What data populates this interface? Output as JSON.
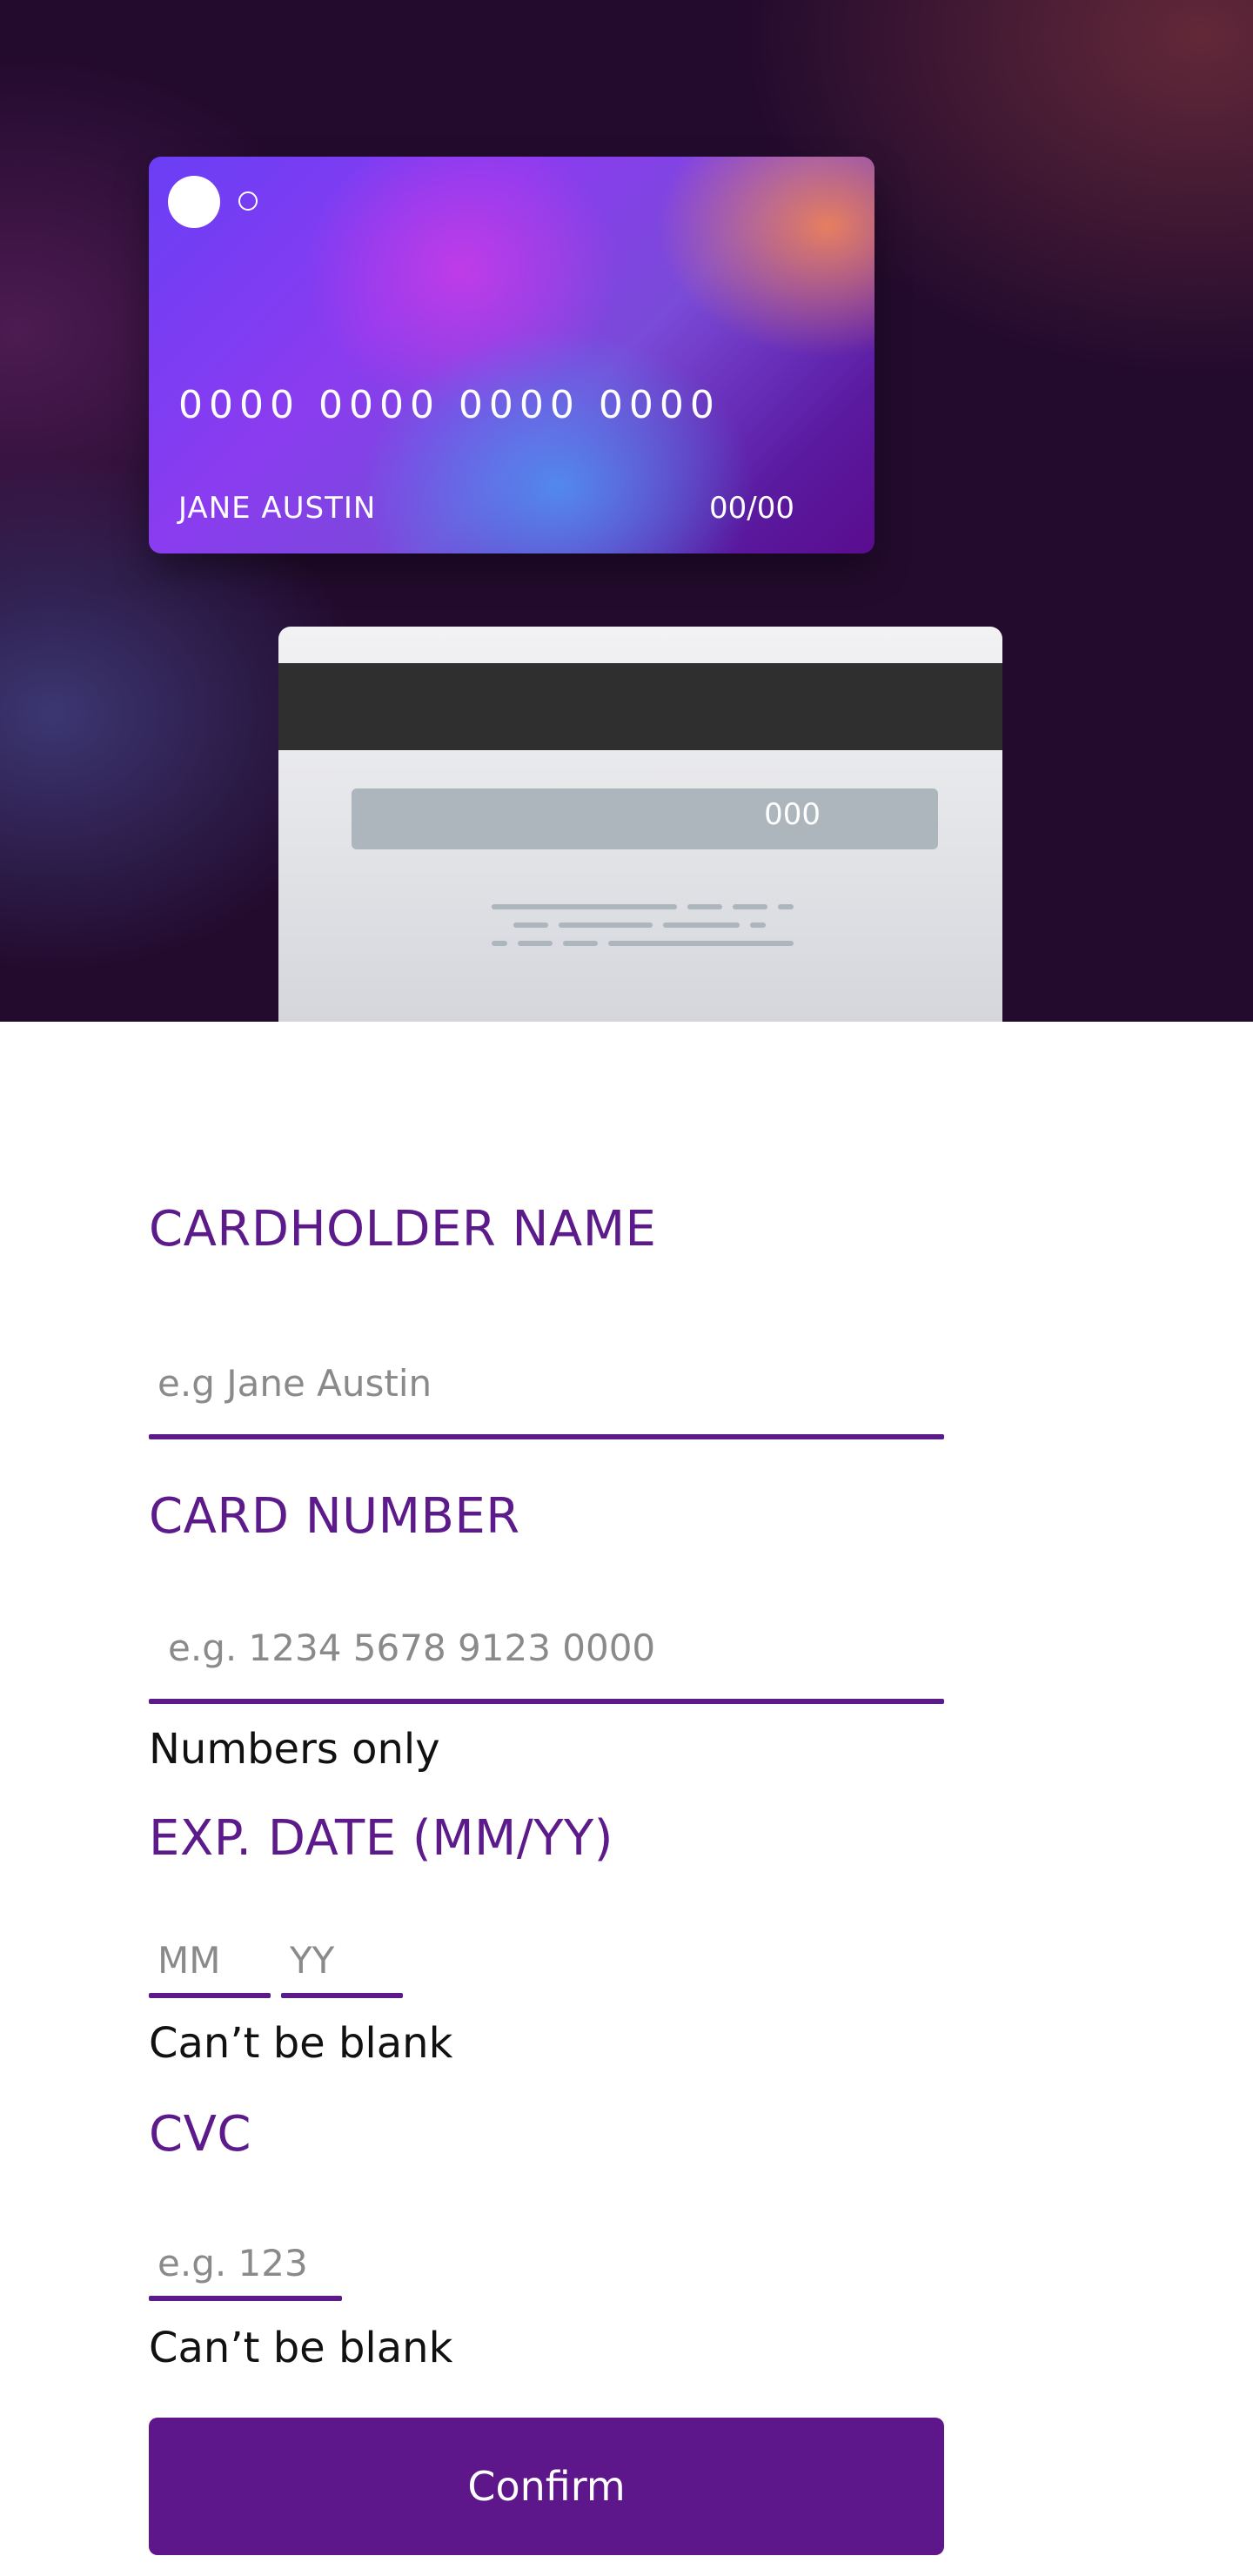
{
  "card_front": {
    "number": "0000 0000 0000 0000",
    "holder": "JANE AUSTIN",
    "expiry": "00/00"
  },
  "card_back": {
    "cvc": "000"
  },
  "form": {
    "name_label": "CARDHOLDER NAME",
    "name_placeholder": "e.g Jane Austin",
    "number_label": "CARD NUMBER",
    "number_placeholder": "e.g. 1234 5678 9123 0000",
    "number_hint": "Numbers only",
    "exp_label": "EXP. DATE (MM/YY)",
    "mm_placeholder": "MM",
    "yy_placeholder": "YY",
    "exp_hint": "Can’t be blank",
    "cvc_label": "CVC",
    "cvc_placeholder": "e.g. 123",
    "cvc_hint": "Can’t be blank",
    "confirm_label": "Confirm"
  },
  "colors": {
    "accent": "#5c1a8a",
    "hero_bg": "#230b2e",
    "button": "#5e178a"
  }
}
